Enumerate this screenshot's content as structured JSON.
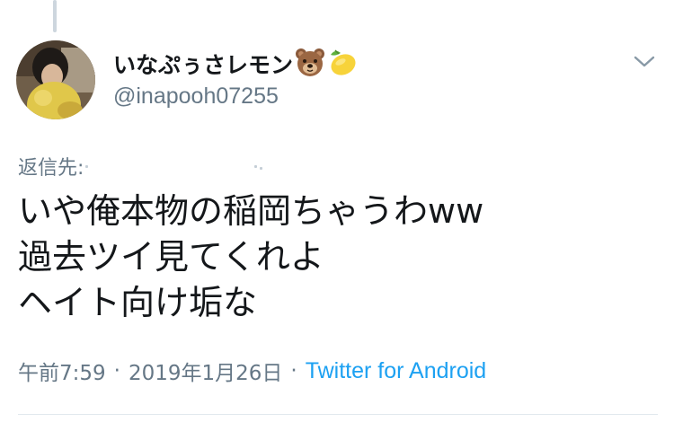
{
  "tweet": {
    "author": {
      "display_name": "いなぷぅさレモン",
      "emoji_icons": [
        "bear-face-icon",
        "lemon-icon"
      ],
      "handle": "@inapooh07255",
      "avatar": "avatar"
    },
    "reply_to_label": "返信先:",
    "text_lines": [
      "いや俺本物の稲岡ちゃうわww",
      "過去ツイ見てくれよ",
      "ヘイト向け垢な"
    ],
    "time": "午前7:59",
    "date": "2019年1月26日",
    "separator": "·",
    "source": "Twitter for Android",
    "colors": {
      "text": "#14171a",
      "secondary": "#657786",
      "link": "#1da1f2",
      "divider": "#e1e8ed",
      "thread_line": "#cdd6de"
    }
  },
  "menu": {
    "icon": "chevron-down-icon"
  }
}
